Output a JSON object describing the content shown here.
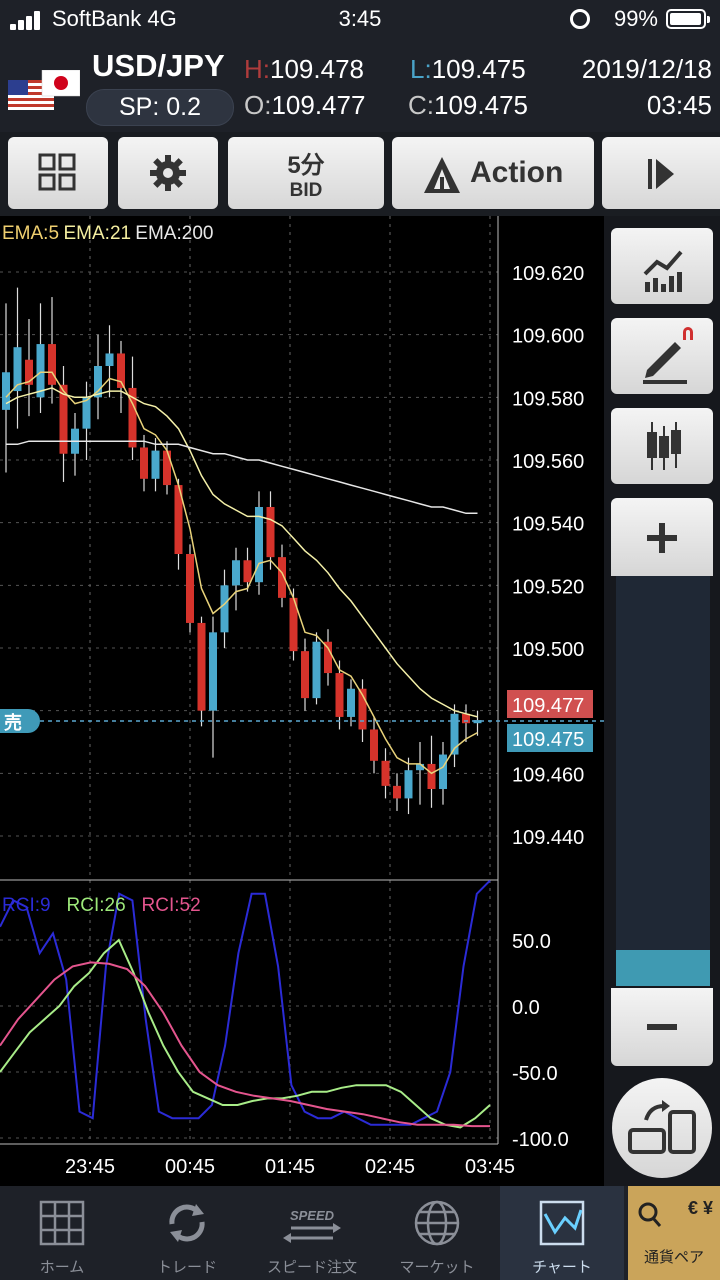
{
  "status_bar": {
    "carrier": "SoftBank 4G",
    "time": "3:45",
    "battery": "99%"
  },
  "quote": {
    "pair": "USD/JPY",
    "spread": "SP: 0.2",
    "high_label": "H:",
    "high": "109.478",
    "low_label": "L:",
    "low": "109.475",
    "open_label": "O:",
    "open": "109.477",
    "close_label": "C:",
    "close": "109.475",
    "date": "2019/12/18",
    "time": "03:45"
  },
  "toolbar": {
    "timeframe": "5分",
    "price_type": "BID",
    "action": "Action"
  },
  "chart": {
    "ema_labels": [
      {
        "text": "EMA:5",
        "color": "#f0d070"
      },
      {
        "text": "EMA:21",
        "color": "#f4eea0"
      },
      {
        "text": "EMA:200",
        "color": "#e8e8e8"
      }
    ],
    "price_ticks": [
      "109.620",
      "109.600",
      "109.580",
      "109.560",
      "109.540",
      "109.520",
      "109.500",
      "109.460",
      "109.440"
    ],
    "ask_price": "109.477",
    "bid_price": "109.475",
    "sell_tag": "売",
    "rci_labels": [
      {
        "text": "RCI:9",
        "color": "#2b2bd6"
      },
      {
        "text": "RCI:26",
        "color": "#9de87a"
      },
      {
        "text": "RCI:52",
        "color": "#e4558e"
      }
    ],
    "rci_ticks": [
      "50.0",
      "0.0",
      "-50.0",
      "-100.0"
    ],
    "time_ticks": [
      "23:45",
      "00:45",
      "01:45",
      "02:45",
      "03:45"
    ],
    "colors": {
      "up": "#4aa8cc",
      "down": "#d6332b",
      "ema5": "#e8d27a",
      "ema21": "#f4f0a8",
      "ema200": "#e6e6e6",
      "ask": "#d05050",
      "bid": "#3f9ab8"
    }
  },
  "chart_data": [
    {
      "type": "candlestick",
      "title": "USD/JPY",
      "xlabel": "",
      "ylabel": "",
      "x_ticks": [
        "23:45",
        "00:45",
        "01:45",
        "02:45",
        "03:45"
      ],
      "ylim": [
        109.43,
        109.63
      ],
      "candles": [
        {
          "o": 109.576,
          "h": 109.61,
          "l": 109.556,
          "c": 109.588,
          "dir": "up"
        },
        {
          "o": 109.582,
          "h": 109.615,
          "l": 109.57,
          "c": 109.596,
          "dir": "up"
        },
        {
          "o": 109.592,
          "h": 109.605,
          "l": 109.574,
          "c": 109.584,
          "dir": "down"
        },
        {
          "o": 109.58,
          "h": 109.61,
          "l": 109.575,
          "c": 109.597,
          "dir": "up"
        },
        {
          "o": 109.597,
          "h": 109.612,
          "l": 109.578,
          "c": 109.584,
          "dir": "down"
        },
        {
          "o": 109.584,
          "h": 109.59,
          "l": 109.553,
          "c": 109.562,
          "dir": "down"
        },
        {
          "o": 109.562,
          "h": 109.575,
          "l": 109.555,
          "c": 109.57,
          "dir": "up"
        },
        {
          "o": 109.57,
          "h": 109.585,
          "l": 109.56,
          "c": 109.58,
          "dir": "up"
        },
        {
          "o": 109.58,
          "h": 109.6,
          "l": 109.573,
          "c": 109.59,
          "dir": "up"
        },
        {
          "o": 109.59,
          "h": 109.603,
          "l": 109.58,
          "c": 109.594,
          "dir": "up"
        },
        {
          "o": 109.594,
          "h": 109.598,
          "l": 109.575,
          "c": 109.583,
          "dir": "down"
        },
        {
          "o": 109.583,
          "h": 109.593,
          "l": 109.56,
          "c": 109.564,
          "dir": "down"
        },
        {
          "o": 109.564,
          "h": 109.568,
          "l": 109.55,
          "c": 109.554,
          "dir": "down"
        },
        {
          "o": 109.554,
          "h": 109.567,
          "l": 109.55,
          "c": 109.563,
          "dir": "up"
        },
        {
          "o": 109.563,
          "h": 109.566,
          "l": 109.549,
          "c": 109.552,
          "dir": "down"
        },
        {
          "o": 109.552,
          "h": 109.554,
          "l": 109.525,
          "c": 109.53,
          "dir": "down"
        },
        {
          "o": 109.53,
          "h": 109.533,
          "l": 109.505,
          "c": 109.508,
          "dir": "down"
        },
        {
          "o": 109.508,
          "h": 109.51,
          "l": 109.475,
          "c": 109.48,
          "dir": "down"
        },
        {
          "o": 109.48,
          "h": 109.51,
          "l": 109.465,
          "c": 109.505,
          "dir": "up"
        },
        {
          "o": 109.505,
          "h": 109.525,
          "l": 109.5,
          "c": 109.52,
          "dir": "up"
        },
        {
          "o": 109.52,
          "h": 109.532,
          "l": 109.512,
          "c": 109.528,
          "dir": "up"
        },
        {
          "o": 109.528,
          "h": 109.532,
          "l": 109.518,
          "c": 109.521,
          "dir": "down"
        },
        {
          "o": 109.521,
          "h": 109.55,
          "l": 109.517,
          "c": 109.545,
          "dir": "up"
        },
        {
          "o": 109.545,
          "h": 109.55,
          "l": 109.525,
          "c": 109.529,
          "dir": "down"
        },
        {
          "o": 109.529,
          "h": 109.533,
          "l": 109.513,
          "c": 109.516,
          "dir": "down"
        },
        {
          "o": 109.516,
          "h": 109.519,
          "l": 109.496,
          "c": 109.499,
          "dir": "down"
        },
        {
          "o": 109.499,
          "h": 109.503,
          "l": 109.48,
          "c": 109.484,
          "dir": "down"
        },
        {
          "o": 109.484,
          "h": 109.505,
          "l": 109.482,
          "c": 109.502,
          "dir": "up"
        },
        {
          "o": 109.502,
          "h": 109.506,
          "l": 109.488,
          "c": 109.492,
          "dir": "down"
        },
        {
          "o": 109.492,
          "h": 109.496,
          "l": 109.474,
          "c": 109.478,
          "dir": "down"
        },
        {
          "o": 109.478,
          "h": 109.49,
          "l": 109.475,
          "c": 109.487,
          "dir": "up"
        },
        {
          "o": 109.487,
          "h": 109.49,
          "l": 109.47,
          "c": 109.474,
          "dir": "down"
        },
        {
          "o": 109.474,
          "h": 109.478,
          "l": 109.46,
          "c": 109.464,
          "dir": "down"
        },
        {
          "o": 109.464,
          "h": 109.468,
          "l": 109.452,
          "c": 109.456,
          "dir": "down"
        },
        {
          "o": 109.456,
          "h": 109.46,
          "l": 109.448,
          "c": 109.452,
          "dir": "down"
        },
        {
          "o": 109.452,
          "h": 109.465,
          "l": 109.447,
          "c": 109.461,
          "dir": "up"
        },
        {
          "o": 109.461,
          "h": 109.47,
          "l": 109.45,
          "c": 109.463,
          "dir": "up"
        },
        {
          "o": 109.463,
          "h": 109.472,
          "l": 109.449,
          "c": 109.455,
          "dir": "down"
        },
        {
          "o": 109.455,
          "h": 109.47,
          "l": 109.45,
          "c": 109.466,
          "dir": "up"
        },
        {
          "o": 109.466,
          "h": 109.482,
          "l": 109.462,
          "c": 109.479,
          "dir": "up"
        },
        {
          "o": 109.479,
          "h": 109.482,
          "l": 109.47,
          "c": 109.476,
          "dir": "down"
        },
        {
          "o": 109.476,
          "h": 109.48,
          "l": 109.472,
          "c": 109.477,
          "dir": "up"
        }
      ],
      "series": [
        {
          "name": "EMA:5",
          "values": [
            109.58,
            109.584,
            109.585,
            109.588,
            109.588,
            109.582,
            109.578,
            109.579,
            109.582,
            109.586,
            109.585,
            109.578,
            109.57,
            109.568,
            109.563,
            109.552,
            109.538,
            109.519,
            109.511,
            109.514,
            109.518,
            109.519,
            109.527,
            109.528,
            109.524,
            109.516,
            109.505,
            109.504,
            109.5,
            109.493,
            109.491,
            109.485,
            109.478,
            109.471,
            109.465,
            109.463,
            109.463,
            109.46,
            109.462,
            109.468,
            109.471,
            109.473
          ]
        },
        {
          "name": "EMA:21",
          "values": [
            109.578,
            109.58,
            109.581,
            109.582,
            109.583,
            109.581,
            109.58,
            109.58,
            109.581,
            109.582,
            109.582,
            109.58,
            109.578,
            109.577,
            109.574,
            109.57,
            109.563,
            109.555,
            109.549,
            109.546,
            109.544,
            109.542,
            109.542,
            109.541,
            109.539,
            109.535,
            109.531,
            109.528,
            109.524,
            109.519,
            109.515,
            109.51,
            109.505,
            109.5,
            109.495,
            109.491,
            109.487,
            109.484,
            109.482,
            109.48,
            109.479,
            109.478
          ]
        },
        {
          "name": "EMA:200",
          "values": [
            109.565,
            109.565,
            109.566,
            109.566,
            109.566,
            109.566,
            109.566,
            109.566,
            109.566,
            109.566,
            109.566,
            109.566,
            109.566,
            109.565,
            109.565,
            109.565,
            109.564,
            109.563,
            109.562,
            109.562,
            109.561,
            109.56,
            109.56,
            109.559,
            109.558,
            109.557,
            109.556,
            109.555,
            109.554,
            109.553,
            109.552,
            109.551,
            109.55,
            109.549,
            109.548,
            109.547,
            109.546,
            109.545,
            109.545,
            109.544,
            109.543,
            109.543
          ]
        }
      ]
    },
    {
      "type": "line",
      "xlabel": "",
      "ylabel": "",
      "x_ticks": [
        "23:45",
        "00:45",
        "01:45",
        "02:45",
        "03:45"
      ],
      "ylim": [
        -100,
        100
      ],
      "series": [
        {
          "name": "RCI:9",
          "values": [
            60,
            80,
            75,
            40,
            55,
            20,
            -80,
            -85,
            30,
            85,
            80,
            -10,
            -80,
            -85,
            -85,
            -85,
            -75,
            -30,
            40,
            85,
            85,
            30,
            -60,
            -80,
            -85,
            -85,
            -80,
            -85,
            -90,
            -90,
            -90,
            -90,
            -85,
            -80,
            -50,
            30,
            85,
            95
          ]
        },
        {
          "name": "RCI:26",
          "values": [
            -50,
            -35,
            -20,
            -10,
            0,
            15,
            25,
            40,
            50,
            25,
            -5,
            -30,
            -50,
            -65,
            -70,
            -75,
            -75,
            -72,
            -70,
            -70,
            -68,
            -65,
            -65,
            -62,
            -60,
            -60,
            -60,
            -65,
            -75,
            -85,
            -90,
            -92,
            -85,
            -75
          ]
        },
        {
          "name": "RCI:52",
          "values": [
            -30,
            -10,
            5,
            20,
            30,
            33,
            32,
            28,
            15,
            -5,
            -30,
            -50,
            -60,
            -65,
            -68,
            -70,
            -72,
            -75,
            -78,
            -80,
            -82,
            -85,
            -88,
            -90,
            -90,
            -90,
            -91,
            -91
          ]
        }
      ]
    }
  ],
  "tabs": [
    {
      "label": "ホーム",
      "icon": "grid-icon"
    },
    {
      "label": "トレード",
      "icon": "refresh-icon"
    },
    {
      "label": "スピード注文",
      "icon": "speed-icon"
    },
    {
      "label": "マーケット",
      "icon": "globe-icon"
    },
    {
      "label": "チャート",
      "icon": "chart-icon"
    },
    {
      "label": "通貨ペア",
      "icon": "currency-pair-icon"
    }
  ],
  "tab_icon_text": {
    "speed": "SPEED",
    "currency_symbols": "€ ¥ $"
  }
}
